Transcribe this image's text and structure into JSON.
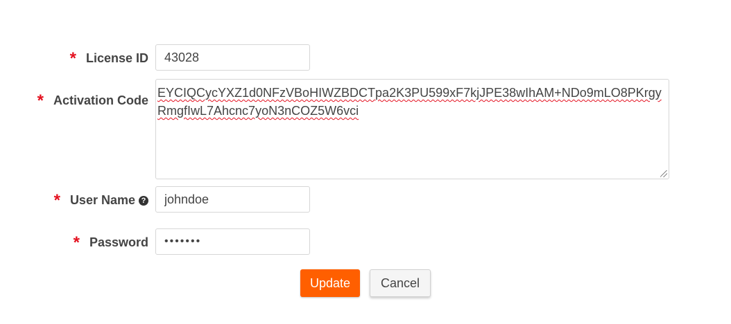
{
  "form": {
    "required_marker": "*",
    "license_id": {
      "label": "License ID",
      "value": "43028"
    },
    "activation_code": {
      "label": "Activation Code",
      "value": "EYCIQCycYXZ1d0NFzVBoHIWZBDCTpa2K3PU599xF7kjJPE38wIhAM+NDo9mLO8PKrgyRmgfIwL7Ahcnc7yoN3nCOZ5W6vci"
    },
    "user_name": {
      "label": "User Name",
      "help_icon": "question-circle-icon",
      "help_glyph": "?",
      "value": "johndoe"
    },
    "password": {
      "label": "Password",
      "masked_value": "•••••••"
    }
  },
  "actions": {
    "update_label": "Update",
    "cancel_label": "Cancel"
  },
  "colors": {
    "accent": "#ff5f00",
    "required": "#e4101f",
    "text": "#444444",
    "border": "#d6d6d6"
  }
}
